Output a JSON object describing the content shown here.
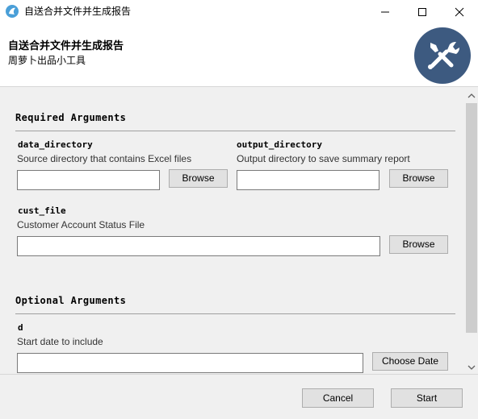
{
  "window": {
    "title": "自送合并文件并生成报告",
    "icon": "app-logo-icon",
    "controls": [
      "minimize-icon",
      "maximize-icon",
      "close-icon"
    ]
  },
  "header": {
    "title": "自送合并文件并生成报告",
    "subtitle": "周萝卜出品小工具",
    "logo": "tools-icon",
    "logo_color": "#3d5a80"
  },
  "required": {
    "heading": "Required Arguments",
    "data_directory": {
      "name": "data_directory",
      "help": "Source directory that contains Excel files",
      "value": "",
      "button": "Browse"
    },
    "output_directory": {
      "name": "output_directory",
      "help": "Output directory to save summary report",
      "value": "",
      "button": "Browse"
    },
    "cust_file": {
      "name": "cust_file",
      "help": "Customer Account Status File",
      "value": "",
      "button": "Browse"
    }
  },
  "optional": {
    "heading": "Optional Arguments",
    "d": {
      "name": "d",
      "help": "Start date to include",
      "value": "",
      "button": "Choose Date"
    }
  },
  "footer": {
    "cancel": "Cancel",
    "start": "Start"
  }
}
